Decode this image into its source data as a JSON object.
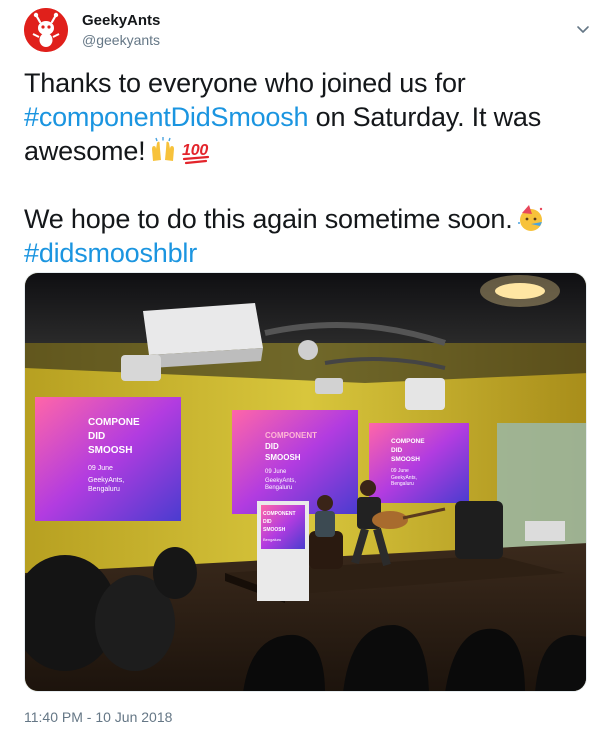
{
  "author": {
    "display_name": "GeekyAnts",
    "handle": "@geekyants",
    "avatar_icon": "ant-logo-icon",
    "avatar_color": "#e0201b"
  },
  "tweet": {
    "line1_prefix": "Thanks to everyone who joined us for",
    "hashtag1": "#componentDidSmoosh",
    "line1_suffix": " on Saturday. It was awesome!",
    "emojis1": [
      "raising-hands-icon",
      "hundred-points-icon"
    ],
    "line2": "We hope to do this again sometime soon.",
    "emoji2": "party-face-icon",
    "hashtag2": "#didsmooshblr"
  },
  "photo": {
    "screen_left": [
      "COMPONE",
      "DID",
      "SMOOSH",
      "09 June",
      "GeekyAnts,",
      "Bengaluru"
    ],
    "screen_center": [
      "COMPONENT",
      "DID",
      "SMOOSH",
      "09 June",
      "GeekyAnts,",
      "Bengaluru"
    ],
    "screen_right": [
      "COMPONE",
      "DID",
      "SMOOSH",
      "09 June",
      "GeekyAnts,",
      "Bengaluru"
    ],
    "podium": [
      "COMPONENT",
      "DID",
      "SMOOSH",
      "Bengaluru"
    ]
  },
  "timestamp": "11:40 PM - 10 Jun 2018",
  "colors": {
    "text": "#14171a",
    "link": "#1b95e0",
    "secondary": "#657786"
  }
}
